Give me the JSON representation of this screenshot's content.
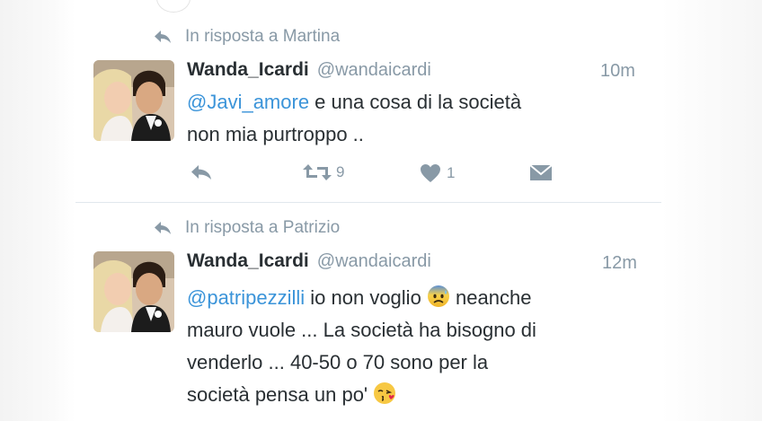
{
  "tweets": [
    {
      "reply_prefix": "In risposta a Martina",
      "name": "Wanda_Icardi",
      "handle": "@wandaicardi",
      "time": "10m",
      "mention": "@Javi_amore",
      "text_line1": " e una cosa di la società",
      "text_line2": "non mia purtroppo ..",
      "retweets": "9",
      "likes": "1"
    },
    {
      "reply_prefix": "In risposta a Patrizio",
      "name": "Wanda_Icardi",
      "handle": "@wandaicardi",
      "time": "12m",
      "mention": "@patripezzilli",
      "text_line1_a": " io non voglio ",
      "text_line1_b": " neanche",
      "text_line2": "mauro vuole ... La società ha bisogno di",
      "text_line3": "venderlo ... 40-50 o 70 sono per la",
      "text_line4": "società pensa un po' ",
      "emoji1": "anxious-face-with-sweat-icon",
      "emoji2": "face-blowing-kiss-icon"
    }
  ],
  "colors": {
    "text": "#292f33",
    "muted": "#8899a6",
    "mention": "#3b94d9",
    "divider": "#e1e8ed"
  }
}
